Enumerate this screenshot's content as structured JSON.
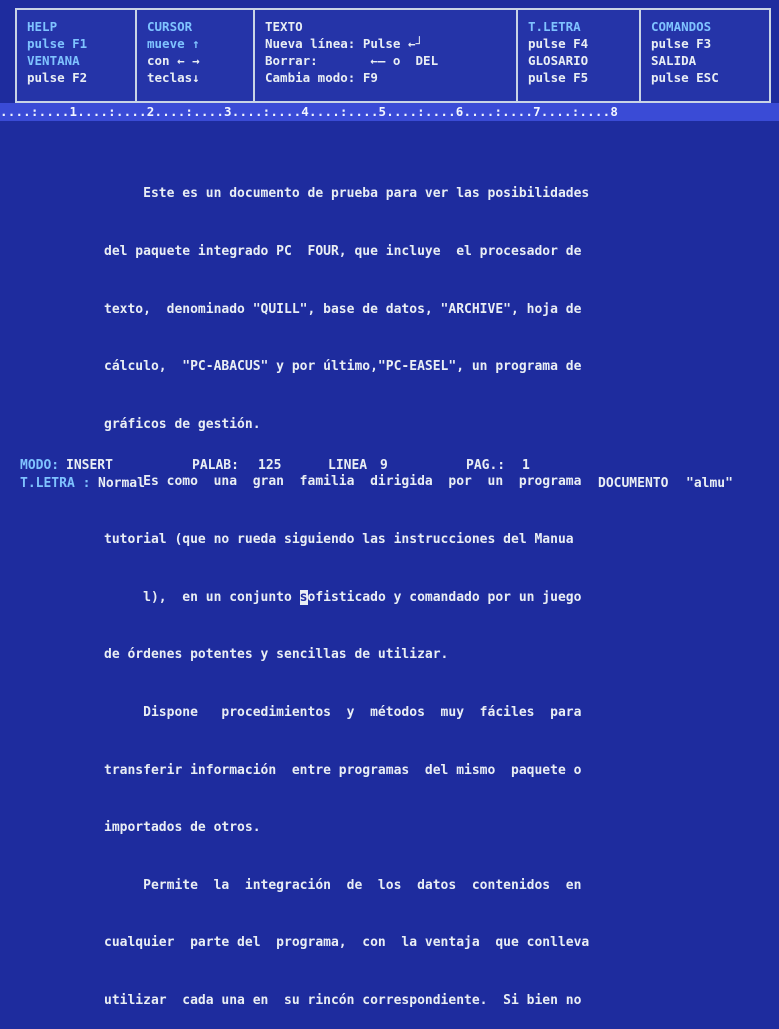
{
  "header": {
    "help": {
      "title": "HELP",
      "line1": "pulse F1",
      "line2": "VENTANA",
      "line3": "pulse F2"
    },
    "cursor": {
      "title": "CURSOR",
      "line1": "mueve ↑",
      "line2": "con ← →",
      "line3": "teclas↓"
    },
    "texto": {
      "title": "TEXTO",
      "line1": "Nueva línea: Pulse ←┘",
      "line2": "Borrar:       ←— o  DEL",
      "line3": "Cambia modo: F9"
    },
    "tletra": {
      "title": "T.LETRA",
      "line1": "pulse F4",
      "line2": "GLOSARIO",
      "line3": "pulse F5"
    },
    "comandos": {
      "title": "COMANDOS",
      "line1": "pulse F3",
      "line2": "SALIDA",
      "line3": "pulse ESC"
    }
  },
  "ruler": "....:....1....:....2....:....3....:....4....:....5....:....6....:....7....:....8",
  "document": {
    "lines": [
      "     Este es un documento de prueba para ver las posibilidades",
      "del paquete integrado PC  FOUR, que incluye  el procesador de",
      "texto,  denominado \"QUILL\", base de datos, \"ARCHIVE\", hoja de",
      "cálculo,  \"PC-ABACUS\" y por último,\"PC-EASEL\", un programa de",
      "gráficos de gestión.",
      "     Es como  una  gran  familia  dirigida  por  un  programa",
      "tutorial (que no rueda siguiendo las instrucciones del Manua",
      "     l),  en un conjunto ",
      "de órdenes potentes y sencillas de utilizar.",
      "     Dispone   procedimientos  y  métodos  muy  fáciles  para",
      "transferir información  entre programas  del mismo  paquete o",
      "importados de otros.",
      "     Permite  la  integración  de  los  datos  contenidos  en",
      "cualquier  parte del  programa,  con  la ventaja  que conlleva",
      "utilizar  cada una en  su rincón correspondiente.  Si bien no"
    ],
    "cursor_char": "s",
    "line8_after": "ofisticado y comandado por un juego"
  },
  "status": {
    "modo_label": "MODO:",
    "modo_value": "INSERT",
    "palab_label": "PALAB:",
    "palab_value": "125",
    "linea_label": "LINEA",
    "linea_value": "9",
    "pag_label": "PAG.:",
    "pag_value": "1",
    "tletra_label": "T.LETRA :",
    "tletra_value": "Normal",
    "documento_label": "DOCUMENTO",
    "documento_value": "\"almu\""
  },
  "colors": {
    "background": "#1e2c9e",
    "ruler": "#3a4bd6",
    "label": "#7fc3ff",
    "text": "#e9eef4",
    "accent": "#f3c56b"
  }
}
